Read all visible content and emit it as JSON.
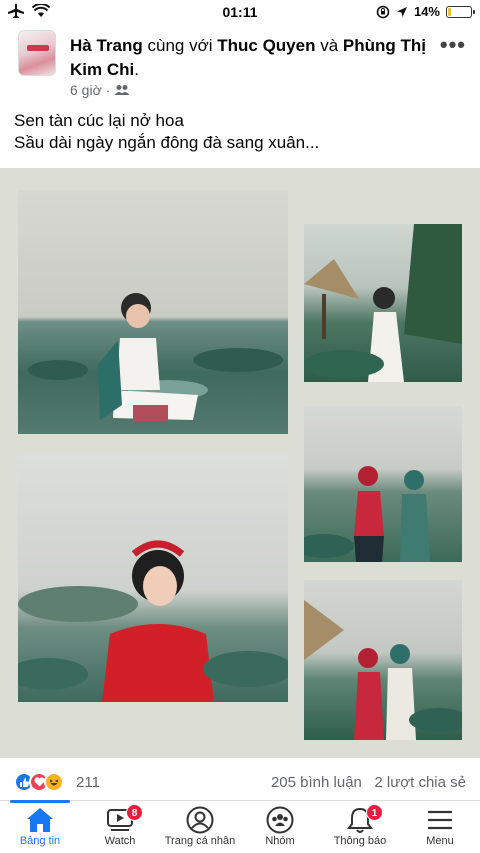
{
  "status_bar": {
    "time": "01:11",
    "battery": "14%",
    "battery_level": 0.14,
    "battery_color": "#f2c12e"
  },
  "post": {
    "author": "Hà Trang",
    "with_text": "cùng với",
    "tag1": "Thuc Quyen",
    "and_text": "và",
    "tag2": "Phùng Thị Kim Chi",
    "period": ".",
    "time_ago": "6 giờ",
    "dot": "·",
    "caption_line1": "Sen tàn cúc lại nở hoa",
    "caption_line2": "Sầu dài ngày ngắn đông đà sang xuân...",
    "more_label": "•••"
  },
  "reactions": {
    "count": "211",
    "comments": "205 bình luận",
    "shares": "2 lượt chia sẻ"
  },
  "tabbar": {
    "items": [
      {
        "label": "Bảng tin",
        "icon": "home-icon",
        "active": true
      },
      {
        "label": "Watch",
        "icon": "watch-icon",
        "badge": "8"
      },
      {
        "label": "Trang cá nhân",
        "icon": "profile-icon"
      },
      {
        "label": "Nhóm",
        "icon": "groups-icon"
      },
      {
        "label": "Thông báo",
        "icon": "bell-icon",
        "badge": "1"
      },
      {
        "label": "Menu",
        "icon": "menu-icon"
      }
    ]
  },
  "colors": {
    "accent": "#1877f2",
    "badge": "#e41e3f",
    "secondary_text": "#65676b"
  }
}
